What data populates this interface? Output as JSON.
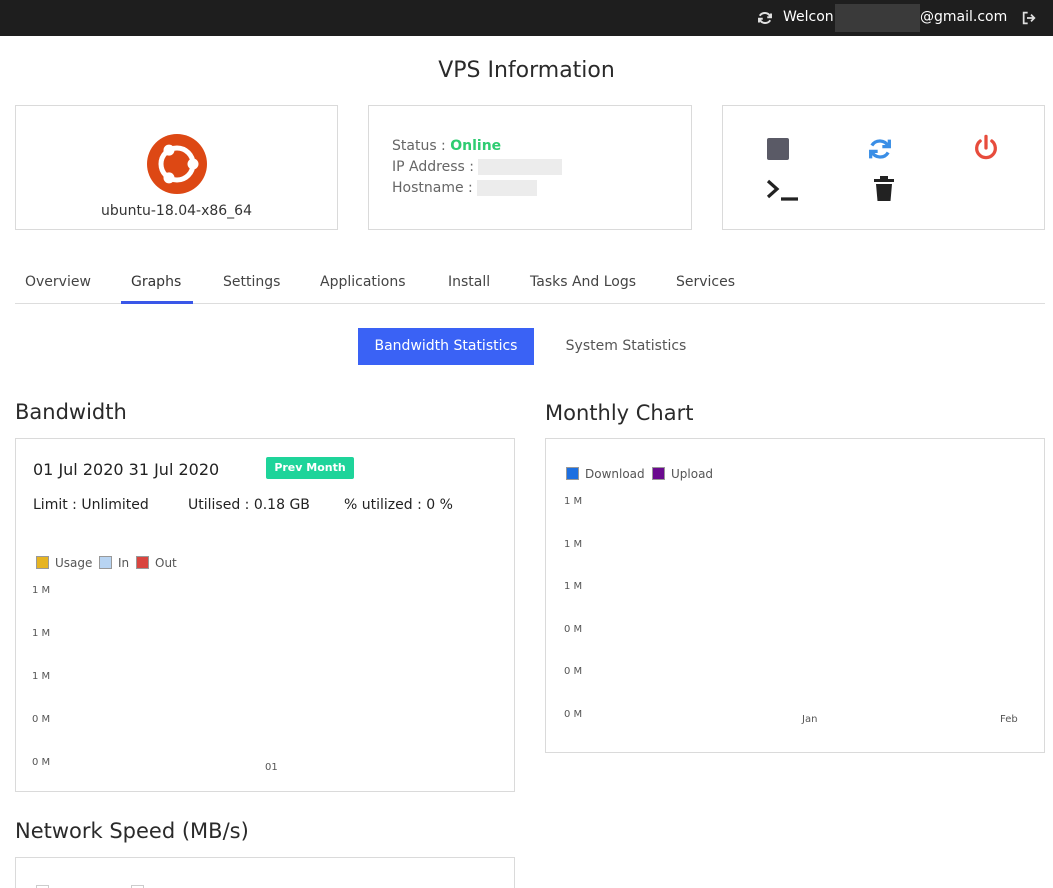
{
  "topbar": {
    "welcome": "Welcon",
    "email": "@gmail.com"
  },
  "page_title": "VPS Information",
  "os": {
    "name": "ubuntu-18.04-x86_64"
  },
  "status": {
    "status_label": "Status : ",
    "status_value": "Online",
    "ip_label": "IP Address : ",
    "hostname_label": "Hostname : "
  },
  "tabs": [
    {
      "label": "Overview"
    },
    {
      "label": "Graphs"
    },
    {
      "label": "Settings"
    },
    {
      "label": "Applications"
    },
    {
      "label": "Install"
    },
    {
      "label": "Tasks And Logs"
    },
    {
      "label": "Services"
    }
  ],
  "active_tab": "Graphs",
  "graph_buttons": {
    "bandwidth": "Bandwidth Statistics",
    "system": "System Statistics"
  },
  "bandwidth": {
    "title": "Bandwidth",
    "date_range": "01 Jul 2020  31 Jul 2020",
    "prev_month": "Prev Month",
    "limit": "Limit : Unlimited",
    "utilised": "Utilised : 0.18 GB",
    "utilized_pct": "% utilized : 0 %"
  },
  "monthly": {
    "title": "Monthly Chart"
  },
  "network": {
    "title": "Network Speed (MB/s)"
  },
  "colors": {
    "accent": "#3a62f5",
    "online": "#2ecc71",
    "badge": "#1ed49a",
    "power": "#e74c3c",
    "refresh": "#3a8ee6",
    "ubuntu": "#dd4814"
  },
  "icons": {
    "topbar_refresh": "refresh-icon",
    "topbar_logout": "logout-icon",
    "stop": "stop-icon",
    "restart": "restart-icon",
    "power": "power-icon",
    "console": "terminal-icon",
    "delete": "trash-icon"
  },
  "chart_data": [
    {
      "type": "bar",
      "legend": [
        "Usage",
        "In",
        "Out"
      ],
      "legend_colors": [
        "#e6b422",
        "#b8d4f2",
        "#d9453f"
      ],
      "categories": [
        "01"
      ],
      "series": [
        {
          "name": "Usage",
          "values": [
            0
          ]
        },
        {
          "name": "In",
          "values": [
            0
          ]
        },
        {
          "name": "Out",
          "values": [
            0
          ]
        }
      ],
      "y_ticks": [
        "1 M",
        "1 M",
        "1 M",
        "0 M",
        "0 M"
      ],
      "legend_position": "top-left"
    },
    {
      "type": "bar",
      "legend": [
        "Download",
        "Upload"
      ],
      "legend_colors": [
        "#1d6fe0",
        "#6a0a8e"
      ],
      "categories": [
        "Jan",
        "Feb"
      ],
      "series": [
        {
          "name": "Download",
          "values": [
            0,
            0
          ]
        },
        {
          "name": "Upload",
          "values": [
            0,
            0
          ]
        }
      ],
      "y_ticks": [
        "1 M",
        "1 M",
        "1 M",
        "0 M",
        "0 M",
        "0 M"
      ],
      "legend_position": "top-left"
    }
  ]
}
